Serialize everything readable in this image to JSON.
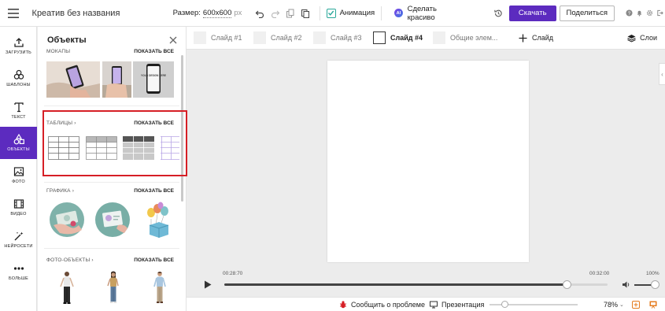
{
  "header": {
    "doc_title": "Креатив без названия",
    "size_label": "Размер:",
    "size_value": "600x600",
    "size_unit": "px",
    "animation_label": "Анимация",
    "ai_badge": "AI",
    "ai_label": "Сделать красиво",
    "download_label": "Скачать",
    "share_label": "Поделиться"
  },
  "rail": {
    "items": [
      {
        "label": "Загрузить",
        "icon": "upload-icon"
      },
      {
        "label": "Шаблоны",
        "icon": "templates-icon"
      },
      {
        "label": "Текст",
        "icon": "text-icon"
      },
      {
        "label": "Объекты",
        "icon": "shapes-icon",
        "active": true
      },
      {
        "label": "Фото",
        "icon": "photo-icon"
      },
      {
        "label": "Видео",
        "icon": "video-icon"
      },
      {
        "label": "Нейросети",
        "icon": "magic-wand-icon"
      },
      {
        "label": "Больше",
        "icon": "more-icon"
      }
    ]
  },
  "panel": {
    "title": "Объекты",
    "show_all": "ПОКАЗАТЬ ВСЕ",
    "sections": {
      "mockups": {
        "title": "МОКАПЫ",
        "show_all": "ПОКАЗАТЬ ВСЕ"
      },
      "tables": {
        "title": "ТАБЛИЦЫ",
        "show_all": "ПОКАЗАТЬ ВСЕ"
      },
      "graphics": {
        "title": "ГРАФИКА",
        "show_all": "ПОКАЗАТЬ ВСЕ"
      },
      "photo_objects": {
        "title": "ФОТО-ОБЪЕКТЫ",
        "show_all": "ПОКАЗАТЬ ВСЕ"
      }
    },
    "mockup_phone_text": "YOUR DESIGN HERE"
  },
  "tabs": {
    "slides": [
      {
        "label": "Слайд #1",
        "active": false
      },
      {
        "label": "Слайд #2",
        "active": false
      },
      {
        "label": "Слайд #3",
        "active": false
      },
      {
        "label": "Слайд #4",
        "active": true
      },
      {
        "label": "Общие элем...",
        "active": false
      }
    ],
    "add_slide_label": "Слайд",
    "layers_label": "Слои"
  },
  "timeline": {
    "current_time": "00:28:70",
    "total_time": "00:32:00",
    "progress": 0.894,
    "volume_label": "100%",
    "volume": 1.0
  },
  "statusbar": {
    "report_label": "Сообщить о проблеме",
    "presentation_label": "Презентация",
    "zoom_value": "78%",
    "zoom_fraction": 0.78
  },
  "colors": {
    "accent": "#5c2bbf",
    "highlight": "#d61f26",
    "checkbox": "#2aa89a",
    "report_icon": "#d61f26",
    "status_icon": "#e57c1f"
  }
}
